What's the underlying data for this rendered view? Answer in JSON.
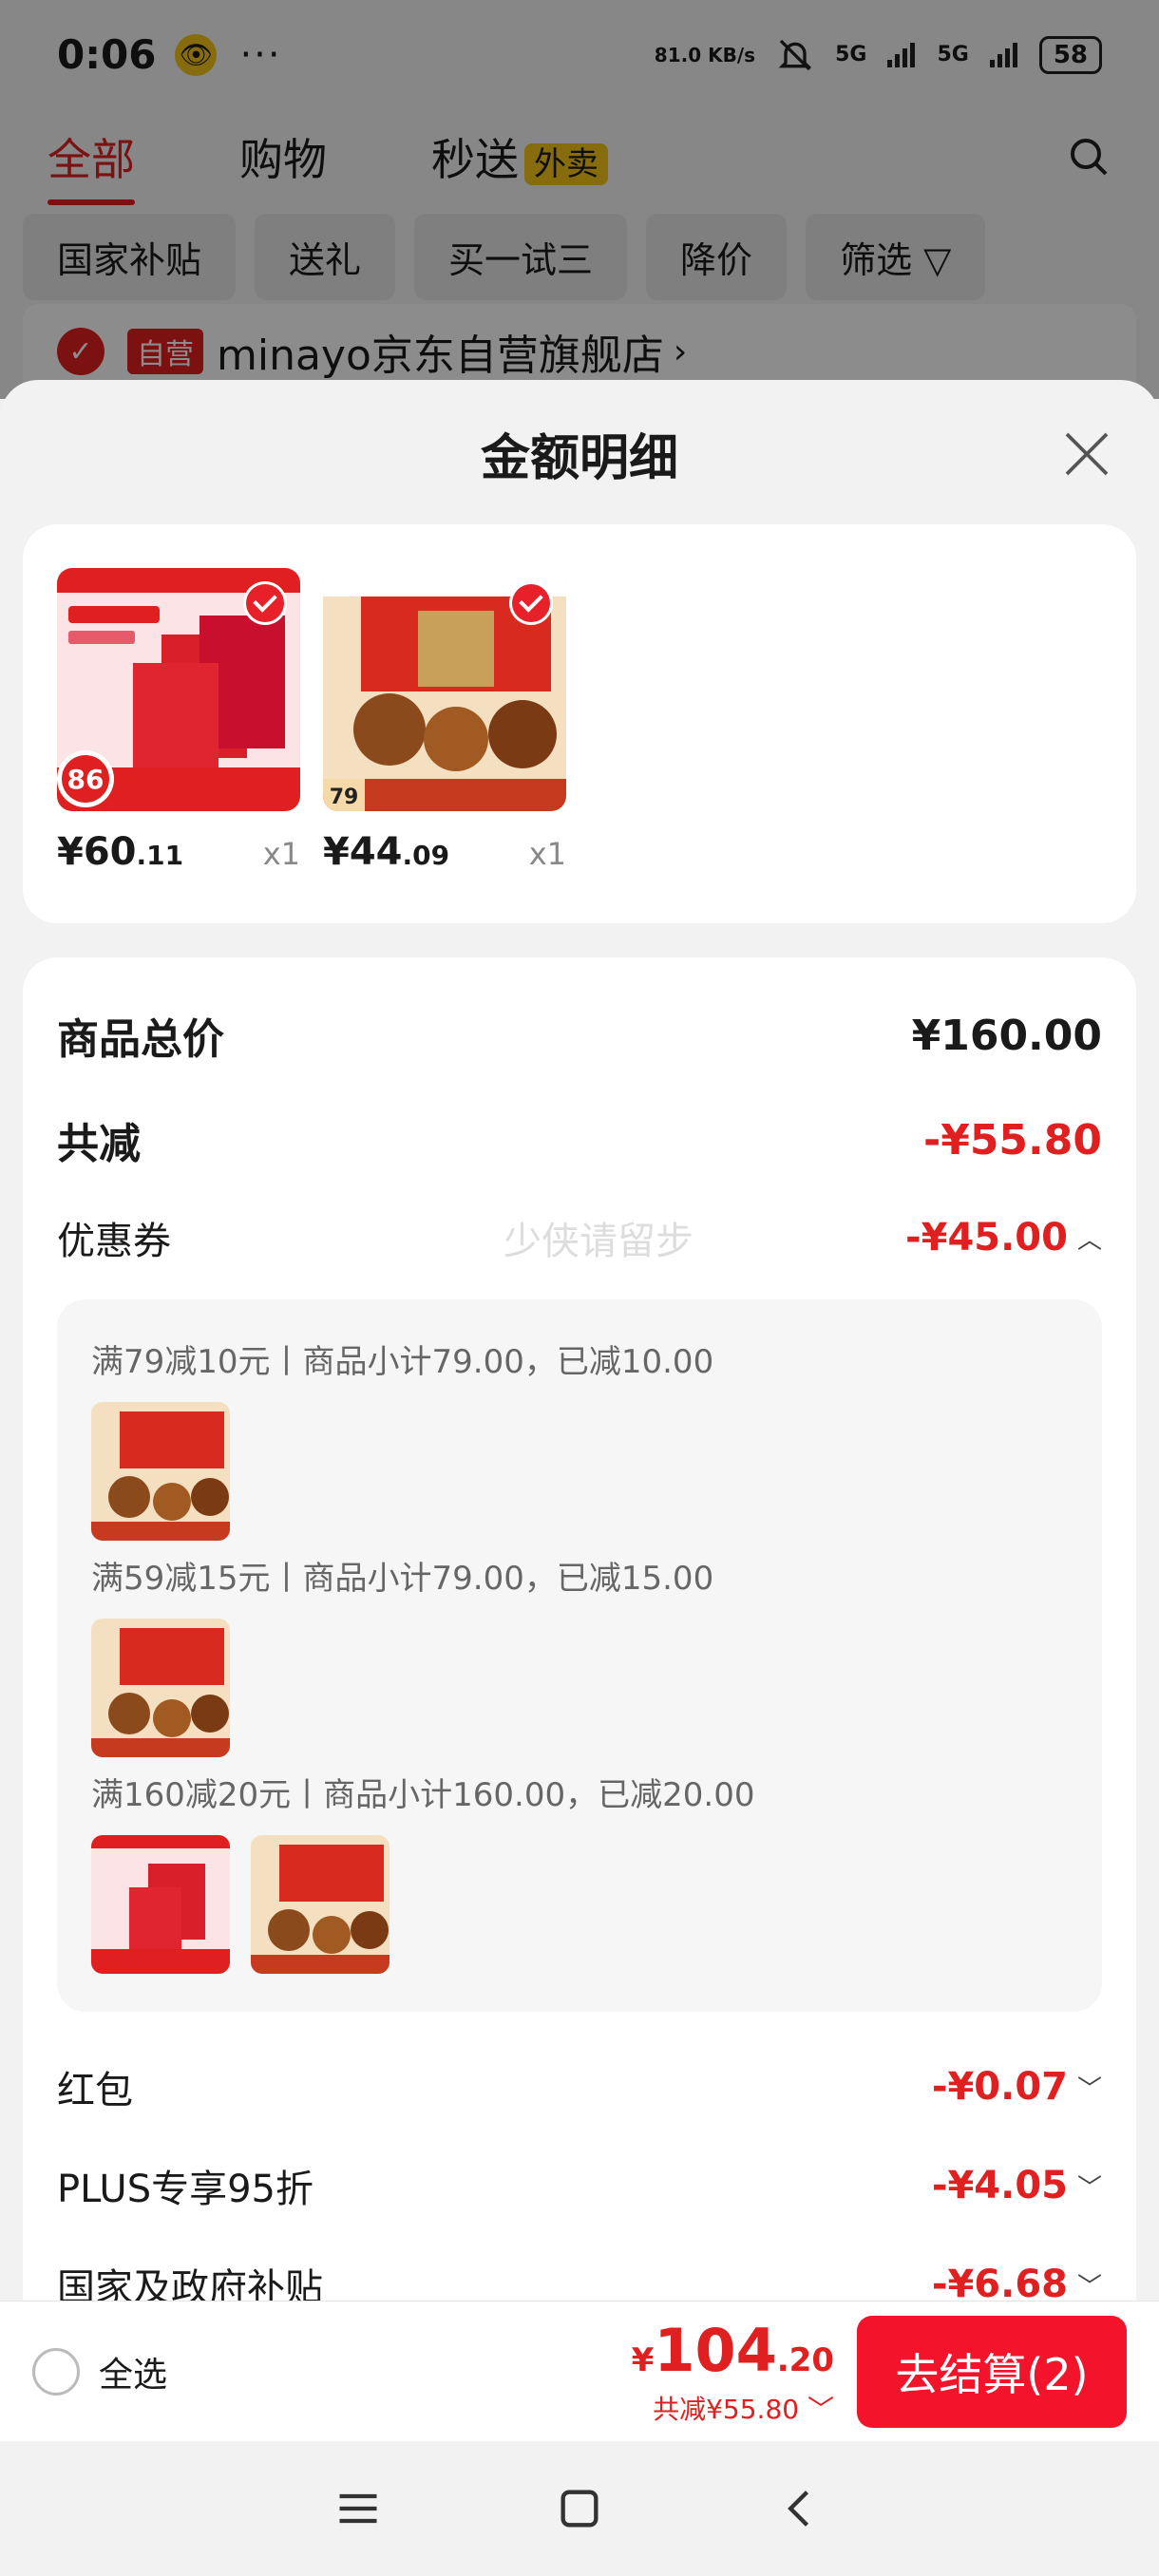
{
  "status_bar": {
    "time": "0:06",
    "speed": "81.0 KB/s",
    "sig1": "5G",
    "sig2": "5G",
    "battery": "58"
  },
  "top_tabs": [
    {
      "label": "全部"
    },
    {
      "label": "购物"
    },
    {
      "label": "秒送"
    }
  ],
  "waimai_badge": "外卖",
  "filters": [
    "国家补贴",
    "送礼",
    "买一试三",
    "降价",
    "筛选"
  ],
  "store": {
    "tag": "自营",
    "name": "minayo京东自营旗舰店",
    "chevron": "›"
  },
  "sheet": {
    "title": "金额明细",
    "products": [
      {
        "price_int": "¥60",
        "price_dec": ".11",
        "qty": "x1",
        "badge": "86"
      },
      {
        "price_int": "¥44",
        "price_dec": ".09",
        "qty": "x1",
        "badge": "79"
      }
    ],
    "summary": {
      "total_label": "商品总价",
      "total_value": "¥160.00",
      "discount_label": "共减",
      "discount_value": "-¥55.80",
      "coupon_label": "优惠券",
      "coupon_value": "-¥45.00",
      "watermark": "少侠请留步"
    },
    "coupon_details": [
      "满79减10元丨商品小计79.00，已减10.00",
      "满59减15元丨商品小计79.00，已减15.00",
      "满160减20元丨商品小计160.00，已减20.00"
    ],
    "other_discounts": [
      {
        "label": "红包",
        "value": "-¥0.07"
      },
      {
        "label": "PLUS专享95折",
        "value": "-¥4.05"
      },
      {
        "label": "国家及政府补贴",
        "value": "-¥6.68"
      }
    ]
  },
  "bottom_bar": {
    "select_all": "全选",
    "total_sym": "¥",
    "total_int": "104",
    "total_dec": ".20",
    "total_discount": "共减¥55.80",
    "checkout": "去结算(2)"
  },
  "colors": {
    "accent": "#e02020",
    "checkout": "#f3142c"
  }
}
